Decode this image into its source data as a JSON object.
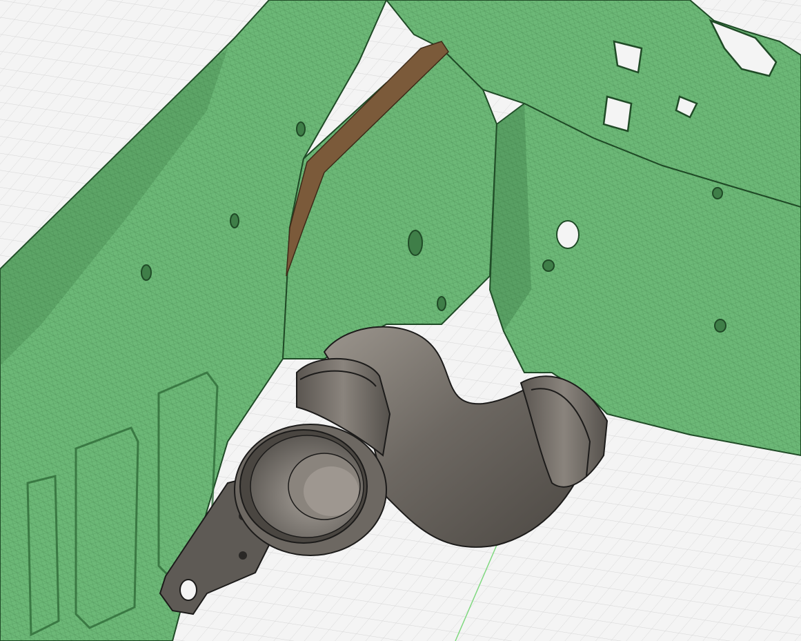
{
  "viewport": {
    "background_color": "#f4f4f4",
    "grid_color": "#d6d6d6",
    "axis_color": "#7fd87f"
  },
  "scan_mesh": {
    "fill_color": "#6cb877",
    "dark_color": "#2f6b38",
    "edge_color": "#1f4a26",
    "exposed_metal_color": "#7b5a3a"
  },
  "duct_part": {
    "body_color": "#6d6862",
    "highlight_color": "#9b958d",
    "shadow_color": "#4a4641",
    "edge_color": "#1c1b1a"
  }
}
